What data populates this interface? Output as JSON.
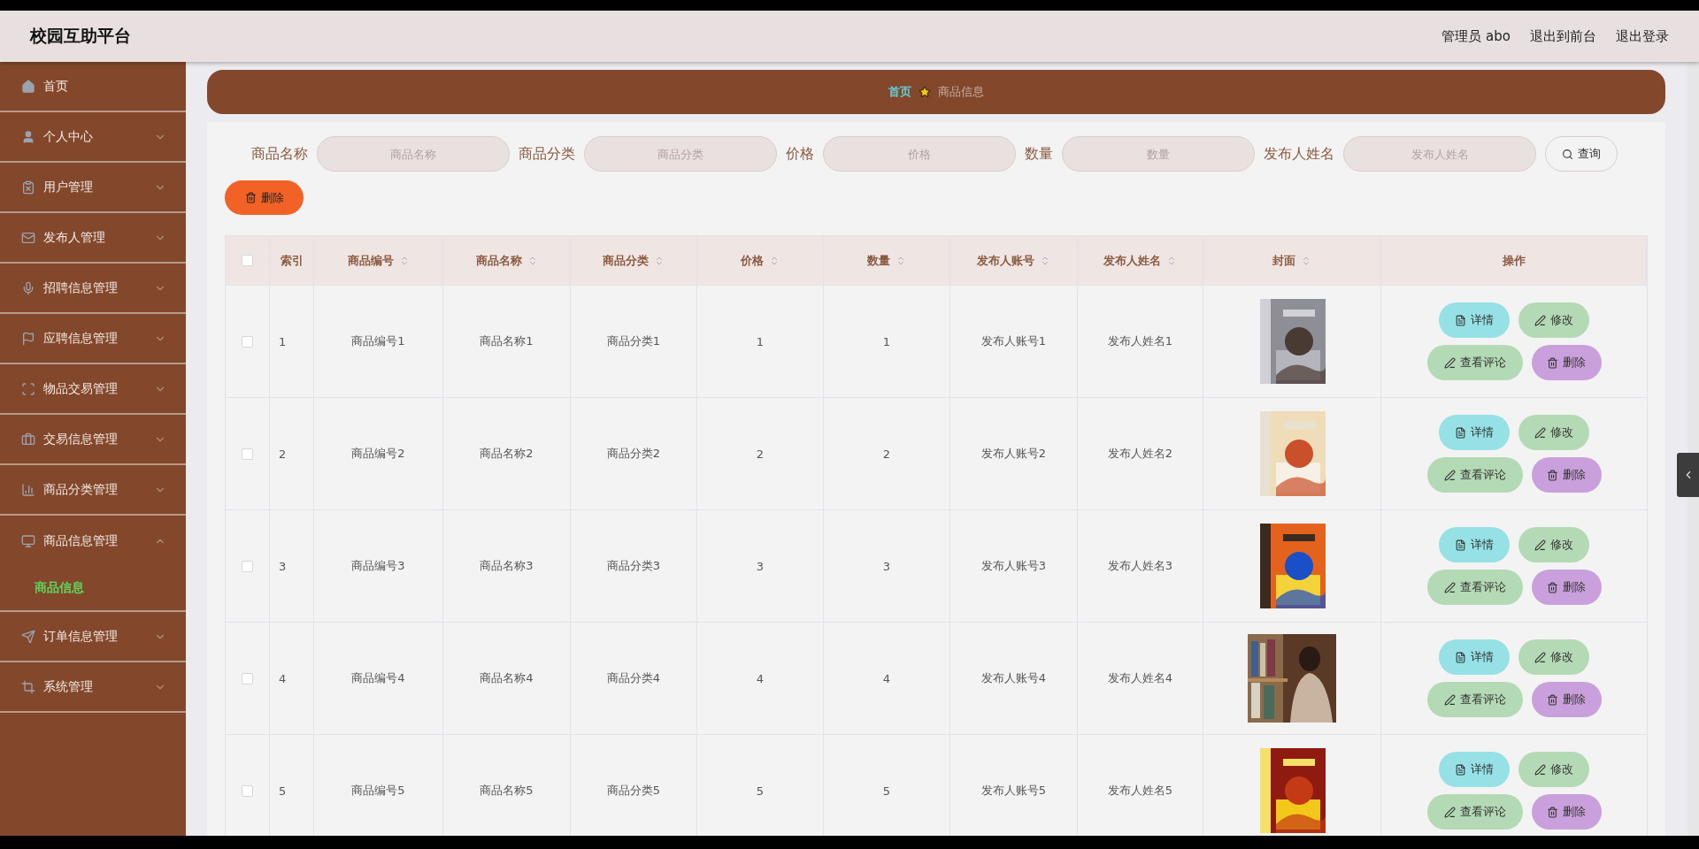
{
  "header": {
    "title": "校园互助平台",
    "user": "管理员 abo",
    "links": [
      "退出到前台",
      "退出登录"
    ]
  },
  "sidebar": {
    "items": [
      {
        "label": "首页",
        "kind": "link"
      },
      {
        "label": "个人中心",
        "kind": "menu",
        "expanded": false
      },
      {
        "label": "用户管理",
        "kind": "menu",
        "expanded": false
      },
      {
        "label": "发布人管理",
        "kind": "menu",
        "expanded": false
      },
      {
        "label": "招聘信息管理",
        "kind": "menu",
        "expanded": false
      },
      {
        "label": "应聘信息管理",
        "kind": "menu",
        "expanded": false
      },
      {
        "label": "物品交易管理",
        "kind": "menu",
        "expanded": false
      },
      {
        "label": "交易信息管理",
        "kind": "menu",
        "expanded": false
      },
      {
        "label": "商品分类管理",
        "kind": "menu",
        "expanded": false
      },
      {
        "label": "商品信息管理",
        "kind": "menu",
        "expanded": true,
        "children": [
          {
            "label": "商品信息",
            "selected": true
          }
        ]
      },
      {
        "label": "订单信息管理",
        "kind": "menu",
        "expanded": false
      },
      {
        "label": "系统管理",
        "kind": "menu",
        "expanded": false
      }
    ]
  },
  "breadcrumb": [
    "首页",
    "商品信息"
  ],
  "search": {
    "fields": [
      {
        "label": "商品名称",
        "placeholder": "商品名称"
      },
      {
        "label": "商品分类",
        "placeholder": "商品分类"
      },
      {
        "label": "价格",
        "placeholder": "价格"
      },
      {
        "label": "数量",
        "placeholder": "数量"
      },
      {
        "label": "发布人姓名",
        "placeholder": "发布人姓名"
      }
    ],
    "button": "查询"
  },
  "bulk_delete": "删除",
  "table": {
    "all_checked": false,
    "columns": [
      {
        "label": "索引",
        "sortable": false
      },
      {
        "label": "商品编号",
        "sortable": true
      },
      {
        "label": "商品名称",
        "sortable": true
      },
      {
        "label": "商品分类",
        "sortable": true
      },
      {
        "label": "价格",
        "sortable": true
      },
      {
        "label": "数量",
        "sortable": true
      },
      {
        "label": "发布人账号",
        "sortable": true
      },
      {
        "label": "发布人姓名",
        "sortable": true
      },
      {
        "label": "封面",
        "sortable": true
      },
      {
        "label": "操作",
        "sortable": false
      }
    ],
    "rows": [
      {
        "checked": false,
        "cells": [
          "1",
          "商品编号1",
          "商品名称1",
          "商品分类1",
          "1",
          "1",
          "发布人账号1",
          "发布人姓名1"
        ],
        "cover": {
          "kind": "picture"
        },
        "actions": [
          {
            "label": "详情",
            "kind": "detail"
          },
          {
            "label": "修改",
            "kind": "edit"
          },
          {
            "label": "查看评论",
            "kind": "comments"
          },
          {
            "label": "删除",
            "kind": "delete"
          }
        ]
      },
      {
        "checked": false,
        "cells": [
          "2",
          "商品编号2",
          "商品名称2",
          "商品分类2",
          "2",
          "2",
          "发布人账号2",
          "发布人姓名2"
        ],
        "cover": {
          "kind": "picture"
        },
        "actions": [
          {
            "label": "详情",
            "kind": "detail"
          },
          {
            "label": "修改",
            "kind": "edit"
          },
          {
            "label": "查看评论",
            "kind": "comments"
          },
          {
            "label": "删除",
            "kind": "delete"
          }
        ]
      },
      {
        "checked": false,
        "cells": [
          "3",
          "商品编号3",
          "商品名称3",
          "商品分类3",
          "3",
          "3",
          "发布人账号3",
          "发布人姓名3"
        ],
        "cover": {
          "kind": "picture"
        },
        "actions": [
          {
            "label": "详情",
            "kind": "detail"
          },
          {
            "label": "修改",
            "kind": "edit"
          },
          {
            "label": "查看评论",
            "kind": "comments"
          },
          {
            "label": "删除",
            "kind": "delete"
          }
        ]
      },
      {
        "checked": false,
        "cells": [
          "4",
          "商品编号4",
          "商品名称4",
          "商品分类4",
          "4",
          "4",
          "发布人账号4",
          "发布人姓名4"
        ],
        "cover": {
          "kind": "picture"
        },
        "actions": [
          {
            "label": "详情",
            "kind": "detail"
          },
          {
            "label": "修改",
            "kind": "edit"
          },
          {
            "label": "查看评论",
            "kind": "comments"
          },
          {
            "label": "删除",
            "kind": "delete"
          }
        ]
      },
      {
        "checked": false,
        "cells": [
          "5",
          "商品编号5",
          "商品名称5",
          "商品分类5",
          "5",
          "5",
          "发布人账号5",
          "发布人姓名5"
        ],
        "cover": {
          "kind": "picture"
        },
        "actions": [
          {
            "label": "详情",
            "kind": "detail"
          },
          {
            "label": "修改",
            "kind": "edit"
          },
          {
            "label": "查看评论",
            "kind": "comments"
          },
          {
            "label": "删除",
            "kind": "delete"
          }
        ]
      }
    ]
  }
}
